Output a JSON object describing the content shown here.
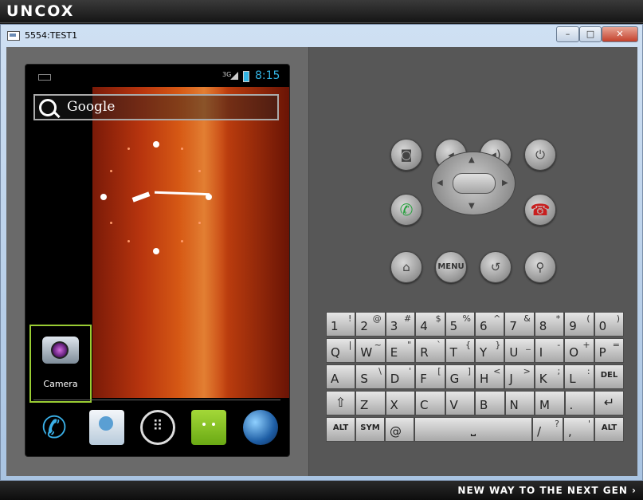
{
  "branding": {
    "logo": "UNCOX",
    "tagline": "NEW WAY TO THE NEXT GEN ›"
  },
  "window": {
    "title": "5554:TEST1",
    "minimize": "–",
    "maximize": "□",
    "close": "✕"
  },
  "status_bar": {
    "network": "3G",
    "time": "8:15"
  },
  "home": {
    "search_label": "Google",
    "shortcut_label": "Camera",
    "apps_glyph": "⠿",
    "phone_glyph": "✆"
  },
  "controls": {
    "menu_label": "MENU",
    "camera_glyph": "◙",
    "vol_down_glyph": "◂",
    "vol_up_glyph": "◂)",
    "power_glyph": "⏻",
    "call_glyph": "✆",
    "end_glyph": "☎",
    "home_glyph": "⌂",
    "back_glyph": "↺",
    "search_glyph": "⚲",
    "up": "▲",
    "down": "▼",
    "left": "◀",
    "right": "▶"
  },
  "keyboard": {
    "row1": [
      {
        "main": "1",
        "sub": "!"
      },
      {
        "main": "2",
        "sub": "@"
      },
      {
        "main": "3",
        "sub": "#"
      },
      {
        "main": "4",
        "sub": "$"
      },
      {
        "main": "5",
        "sub": "%"
      },
      {
        "main": "6",
        "sub": "^"
      },
      {
        "main": "7",
        "sub": "&"
      },
      {
        "main": "8",
        "sub": "*"
      },
      {
        "main": "9",
        "sub": "("
      },
      {
        "main": "0",
        "sub": ")"
      }
    ],
    "row2": [
      {
        "main": "Q",
        "sub": "|"
      },
      {
        "main": "W",
        "sub": "~"
      },
      {
        "main": "E",
        "sub": "\""
      },
      {
        "main": "R",
        "sub": "`"
      },
      {
        "main": "T",
        "sub": "{"
      },
      {
        "main": "Y",
        "sub": "}"
      },
      {
        "main": "U",
        "sub": "_"
      },
      {
        "main": "I",
        "sub": "-"
      },
      {
        "main": "O",
        "sub": "+"
      },
      {
        "main": "P",
        "sub": "="
      }
    ],
    "row3": [
      {
        "main": "A",
        "sub": ""
      },
      {
        "main": "S",
        "sub": "\\"
      },
      {
        "main": "D",
        "sub": "'"
      },
      {
        "main": "F",
        "sub": "["
      },
      {
        "main": "G",
        "sub": "]"
      },
      {
        "main": "H",
        "sub": "<"
      },
      {
        "main": "J",
        "sub": ">"
      },
      {
        "main": "K",
        "sub": ";"
      },
      {
        "main": "L",
        "sub": ":"
      }
    ],
    "del_label": "DEL",
    "row4": [
      {
        "main": "Z",
        "sub": ""
      },
      {
        "main": "X",
        "sub": ""
      },
      {
        "main": "C",
        "sub": ""
      },
      {
        "main": "V",
        "sub": ""
      },
      {
        "main": "B",
        "sub": ""
      },
      {
        "main": "N",
        "sub": ""
      },
      {
        "main": "M",
        "sub": ""
      },
      {
        "main": ".",
        "sub": ""
      }
    ],
    "shift_glyph": "⇧",
    "enter_glyph": "↵",
    "alt_label": "ALT",
    "sym_label": "SYM",
    "at_key": "@",
    "space_glyph": "⎵",
    "slash_key": {
      "main": "/",
      "sub": "?"
    },
    "comma_key": {
      "main": ",",
      "sub": "'"
    }
  }
}
